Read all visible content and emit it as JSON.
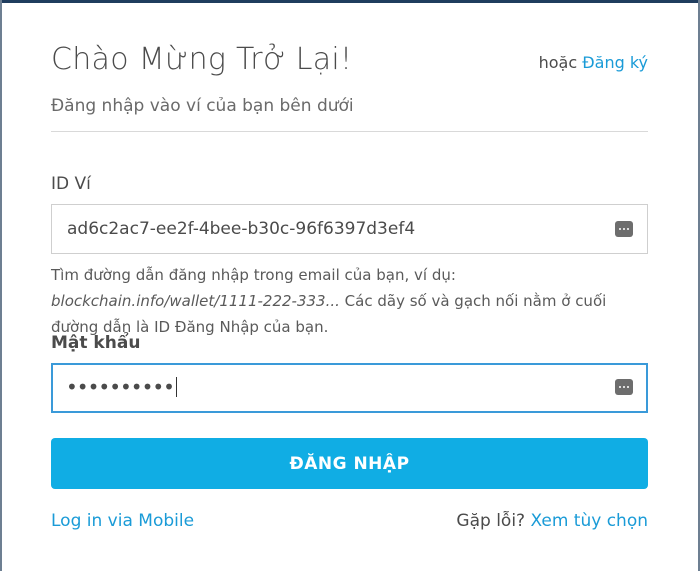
{
  "header": {
    "title": "Chào Mừng Trở Lại!",
    "or_text": "hoặc",
    "signup_label": "Đăng ký",
    "subtitle": "Đăng nhập vào ví của bạn bên dưới"
  },
  "wallet_id": {
    "label": "ID Ví",
    "value": "ad6c2ac7-ee2f-4bee-b30c-96f6397d3ef4",
    "icon": "keyboard-icon",
    "help_prefix": "Tìm đường dẫn đăng nhập trong email của bạn, ví dụ: ",
    "help_example": "blockchain.info/wallet/1111-222-333...",
    "help_suffix": " Các dãy số và gạch nối nằm ở cuối đường dẫn là ID Đăng Nhập của bạn."
  },
  "password": {
    "label": "Mật khẩu",
    "value": "••••••••••",
    "icon": "keyboard-icon"
  },
  "actions": {
    "login_label": "ĐĂNG NHẬP",
    "mobile_login_label": "Log in via Mobile",
    "trouble_text": "Gặp lỗi?",
    "options_label": "Xem tùy chọn"
  },
  "colors": {
    "accent": "#10ade4",
    "link": "#1a9bd7",
    "focus_border": "#3a9ad9"
  }
}
